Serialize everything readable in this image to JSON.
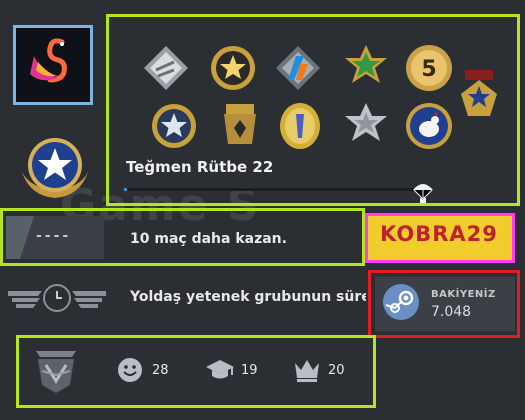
{
  "profile": {
    "rank_title": "Teğmen Rütbe 22",
    "xp_progress": 0.01
  },
  "missions": {
    "win_text": "10 maç daha kazan.",
    "rank_chip_text": "----",
    "skill_group_text": "Yoldaş yetenek grubunun süre"
  },
  "overlay": {
    "code": "KOBRA29",
    "watermark": "Game S"
  },
  "wallet": {
    "label": "BAKİYENİZ",
    "value": "7.048"
  },
  "commendations": {
    "friendly": "28",
    "teacher": "19",
    "leader": "20"
  },
  "colors": {
    "highlight_green": "#b5e61d",
    "highlight_pink": "#ff3cf7",
    "highlight_red": "#e31b23",
    "code_bg": "#f0cc2d",
    "code_text": "#c02030"
  },
  "medals": [
    "shattered-web-coin",
    "gold-star-coin",
    "operation-coin",
    "green-star-pin",
    "five-year-coin",
    "service-medal",
    "silver-star-coin",
    "counter-terrorist-pin",
    "bronze-coin",
    "silver-star-pin",
    "chicken-coin",
    "small-badge"
  ]
}
